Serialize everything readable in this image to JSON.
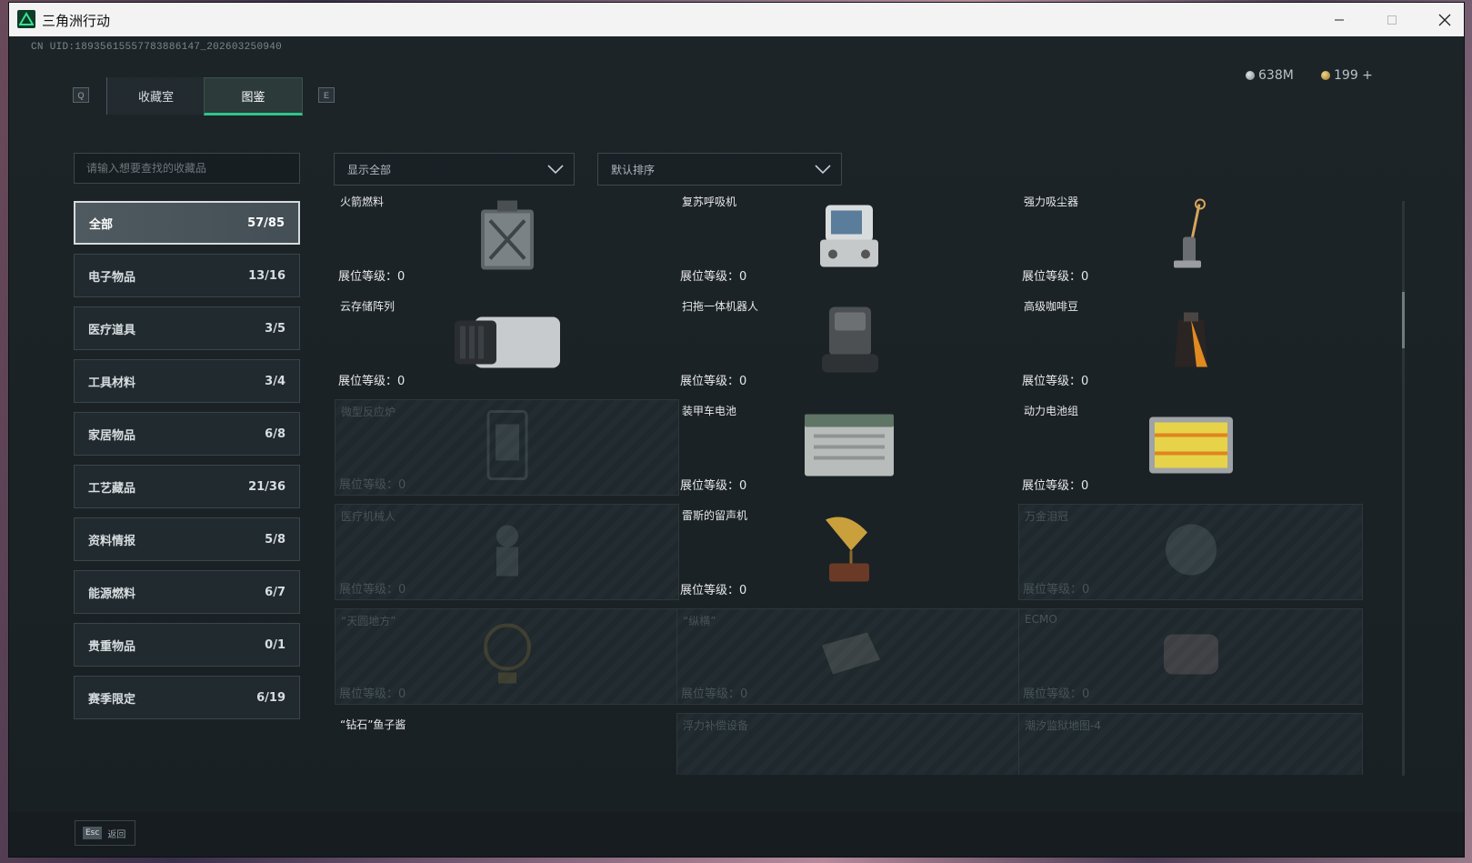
{
  "window": {
    "title": "三角洲行动"
  },
  "uid": "CN UID:18935615557783886147_202603250940",
  "keys": {
    "prev": "Q",
    "next": "E",
    "esc": "Esc"
  },
  "tabs": [
    {
      "label": "收藏室"
    },
    {
      "label": "图鉴"
    }
  ],
  "currency": {
    "silver": "638M",
    "gold": "199 +"
  },
  "search": {
    "placeholder": "请输入想要查找的收藏品"
  },
  "filters": {
    "show": "显示全部",
    "sort": "默认排序"
  },
  "categories": [
    {
      "label": "全部",
      "count": "57/85"
    },
    {
      "label": "电子物品",
      "count": "13/16"
    },
    {
      "label": "医疗道具",
      "count": "3/5"
    },
    {
      "label": "工具材料",
      "count": "3/4"
    },
    {
      "label": "家居物品",
      "count": "6/8"
    },
    {
      "label": "工艺藏品",
      "count": "21/36"
    },
    {
      "label": "资料情报",
      "count": "5/8"
    },
    {
      "label": "能源燃料",
      "count": "6/7"
    },
    {
      "label": "贵重物品",
      "count": "0/1"
    },
    {
      "label": "赛季限定",
      "count": "6/19"
    }
  ],
  "items": [
    {
      "name": "火箭燃料",
      "level": "展位等级：0",
      "owned": true,
      "icon": "fuel-can-icon"
    },
    {
      "name": "复苏呼吸机",
      "level": "展位等级：0",
      "owned": true,
      "icon": "ventilator-icon"
    },
    {
      "name": "强力吸尘器",
      "level": "展位等级：0",
      "owned": true,
      "icon": "vacuum-icon"
    },
    {
      "name": "云存储阵列",
      "level": "展位等级：0",
      "owned": true,
      "icon": "storage-array-icon"
    },
    {
      "name": "扫拖一体机器人",
      "level": "展位等级：0",
      "owned": true,
      "icon": "mop-robot-icon"
    },
    {
      "name": "高级咖啡豆",
      "level": "展位等级：0",
      "owned": true,
      "icon": "coffee-bag-icon"
    },
    {
      "name": "微型反应炉",
      "level": "展位等级：0",
      "owned": false,
      "icon": "reactor-icon"
    },
    {
      "name": "装甲车电池",
      "level": "展位等级：0",
      "owned": true,
      "icon": "battery-icon"
    },
    {
      "name": "动力电池组",
      "level": "展位等级：0",
      "owned": true,
      "icon": "battery-pack-icon"
    },
    {
      "name": "医疗机械人",
      "level": "展位等级：0",
      "owned": false,
      "icon": "medical-robot-icon"
    },
    {
      "name": "雷斯的留声机",
      "level": "展位等级：0",
      "owned": true,
      "icon": "gramophone-icon"
    },
    {
      "name": "万金泪冠",
      "level": "展位等级：0",
      "owned": false,
      "icon": "crown-icon"
    },
    {
      "name": "“天圆地方”",
      "level": "展位等级：0",
      "owned": false,
      "icon": "globe-icon"
    },
    {
      "name": "“纵横”",
      "level": "展位等级：0",
      "owned": false,
      "icon": "board-icon"
    },
    {
      "name": "ECMO",
      "level": "展位等级：0",
      "owned": false,
      "icon": "ecmo-icon"
    },
    {
      "name": "“钻石”鱼子酱",
      "level": "",
      "owned": true,
      "icon": "caviar-tin-icon"
    },
    {
      "name": "浮力补偿设备",
      "level": "",
      "owned": false,
      "icon": "bcd-icon"
    },
    {
      "name": "潮汐监狱地图-4",
      "level": "",
      "owned": false,
      "icon": "map-icon"
    }
  ],
  "footer": {
    "back_label": "返回"
  }
}
